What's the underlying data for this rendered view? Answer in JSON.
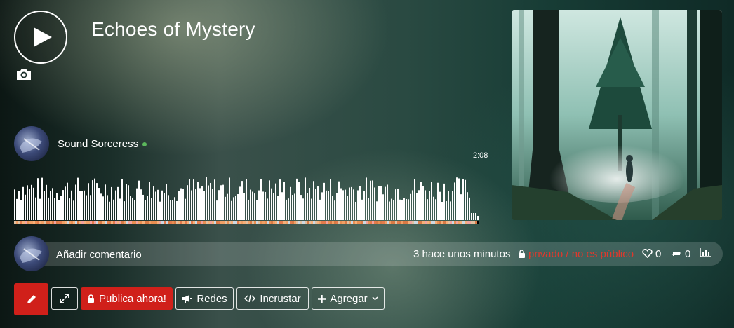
{
  "track": {
    "title": "Echoes of Mystery",
    "artist": "Sound Sorceress",
    "duration": "2:08"
  },
  "comment": {
    "placeholder": "Añadir comentario",
    "timestamp": "3 hace unos minutos",
    "privacy": "privado / no es público",
    "likes": "0",
    "reposts": "0"
  },
  "actions": {
    "publish_label": "Publica ahora!",
    "social_label": "Redes",
    "embed_label": "Incrustar",
    "add_label": "Agregar"
  },
  "colors": {
    "accent_red": "#d0201a",
    "online_green": "#5cb85c",
    "privacy_red": "#e0382c"
  },
  "icons": [
    "play-icon",
    "camera-icon",
    "lock-icon",
    "heart-icon",
    "repost-icon",
    "stats-icon",
    "pencil-icon",
    "expand-icon",
    "megaphone-icon",
    "code-icon",
    "plus-icon",
    "chevron-down-icon"
  ]
}
